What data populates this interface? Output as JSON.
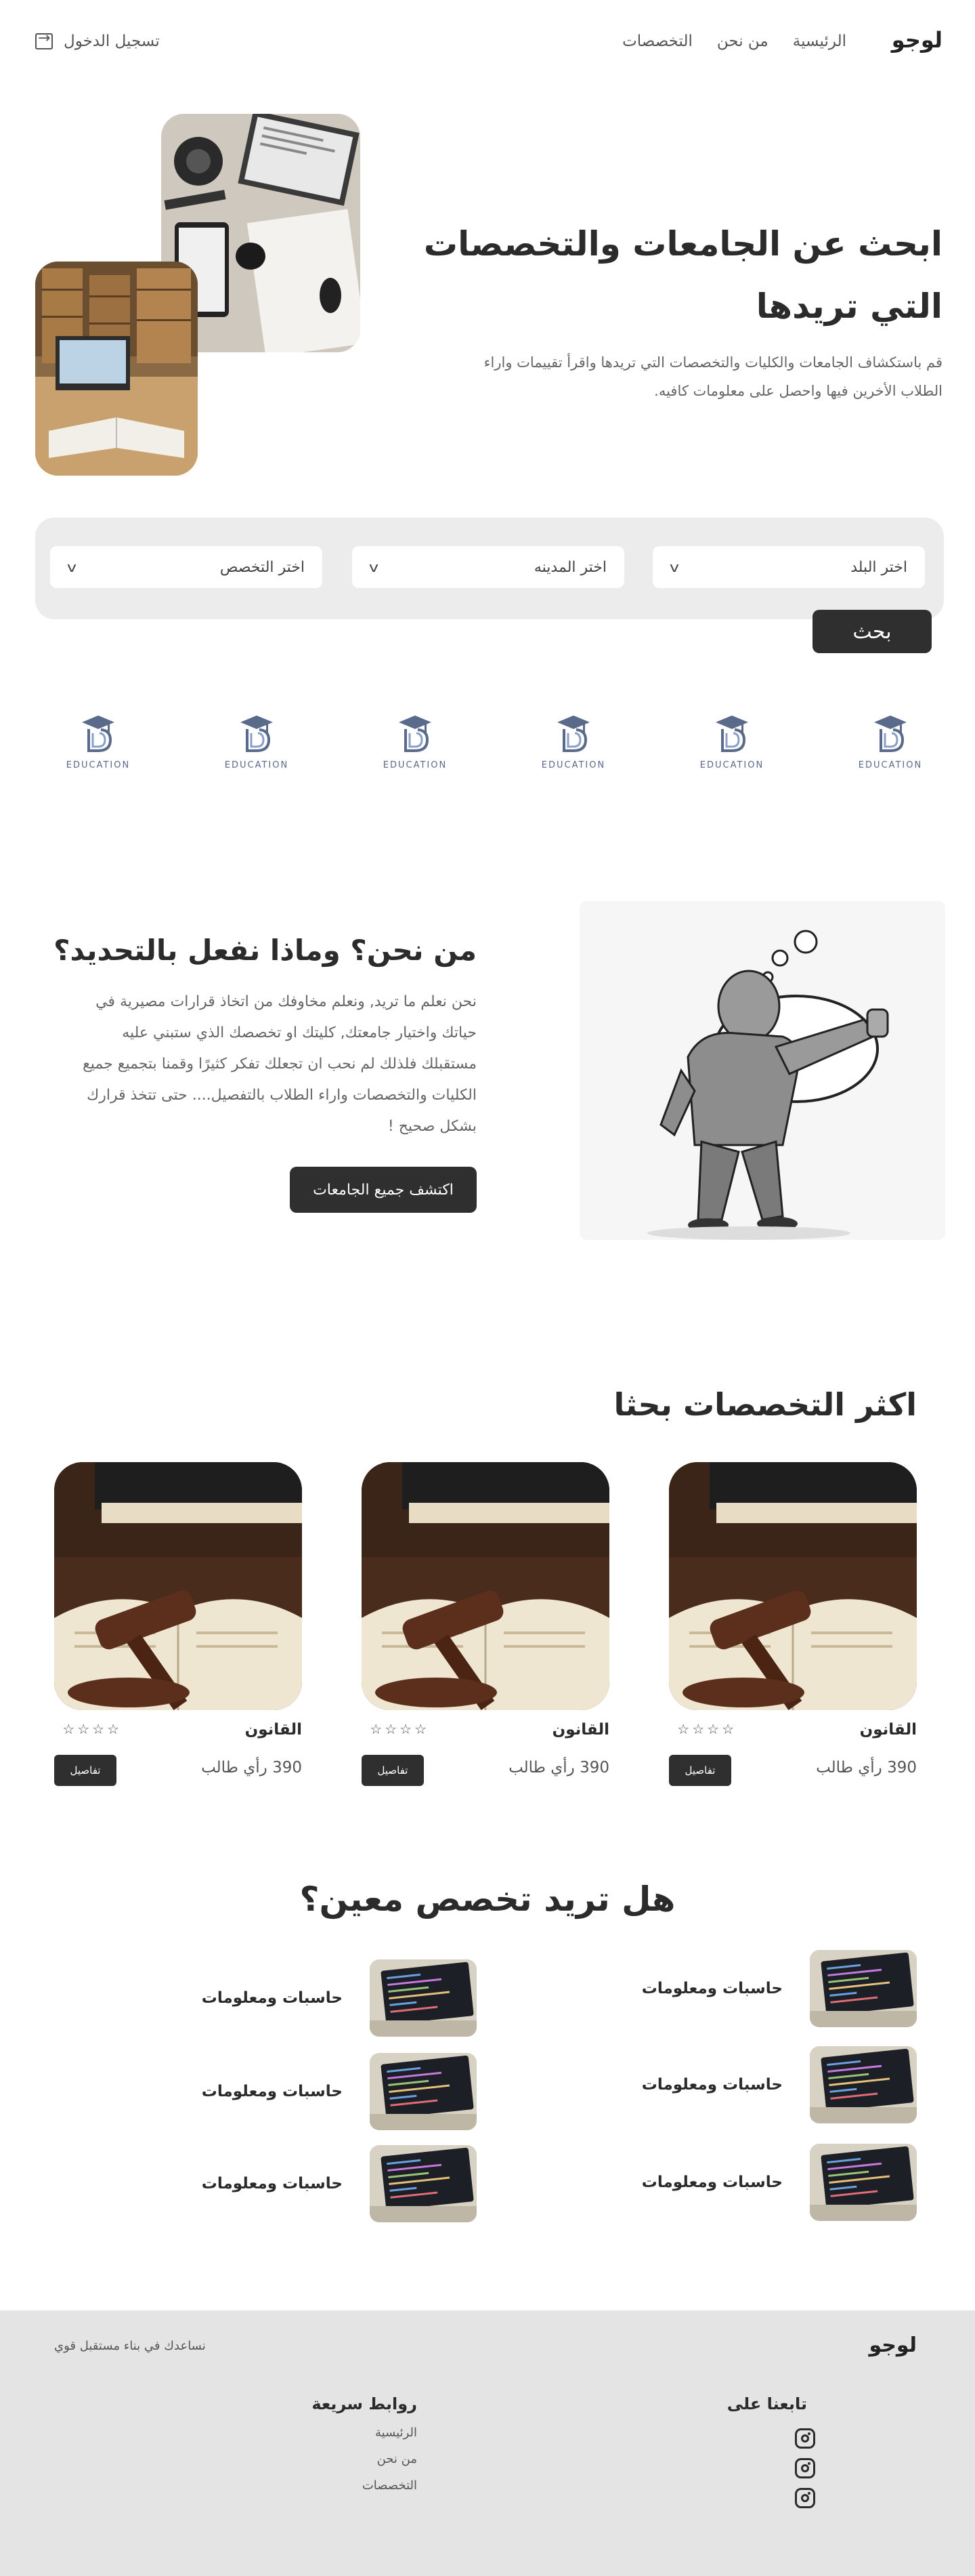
{
  "header": {
    "logo": "لوجو",
    "nav": [
      "الرئيسية",
      "من نحن",
      "التخصصات"
    ],
    "login_label": "تسجيل الدخول"
  },
  "hero": {
    "title_line1": "ابحث عن الجامعات والتخصصات",
    "title_line2": "التي تريدها",
    "subtitle_line1": "قم باستكشاف الجامعات والكليات والتخصصات التي تريدها واقرأ تقييمات واراء",
    "subtitle_line2": "الطلاب الأخرين فيها واحصل على معلومات كافيه."
  },
  "search": {
    "country_placeholder": "اختر البلد",
    "city_placeholder": "اختر المدينه",
    "major_placeholder": "اختر التخصص",
    "chevron": "v",
    "button_label": "بحث"
  },
  "partners": {
    "label": "EDUCATION",
    "count": 6,
    "icon": "graduation-cap-icon"
  },
  "about": {
    "title": "من نحن؟ وماذا نفعل بالتحديد؟",
    "lines": [
      "نحن نعلم ما تريد, ونعلم مخاوفك من اتخاذ قرارات مصيرية في",
      "حياتك واختيار جامعتك, كليتك او تخصصك الذي ستبني عليه",
      "مستقبلك فلذلك لم نحب ان تجعلك تفكر كثيرًا وقمنا بتجميع جميع",
      "الكليات والتخصصات واراء الطلاب بالتفصيل.... حتى تتخذ قرارك",
      "بشكل صحيح !"
    ],
    "button_label": "اكتشف جميع الجامعات"
  },
  "popular": {
    "title": "اكثر التخصصات بحثا",
    "cards": [
      {
        "name": "القانون",
        "stars": "☆☆☆☆",
        "count": "390 رأي طالب",
        "button": "تفاصيل"
      },
      {
        "name": "القانون",
        "stars": "☆☆☆☆",
        "count": "390 رأي طالب",
        "button": "تفاصيل"
      },
      {
        "name": "القانون",
        "stars": "☆☆☆☆",
        "count": "390 رأي طالب",
        "button": "تفاصيل"
      }
    ]
  },
  "specific": {
    "title": "هل تريد تخصص معين؟",
    "items": [
      "حاسبات ومعلومات",
      "حاسبات ومعلومات",
      "حاسبات ومعلومات",
      "حاسبات ومعلومات",
      "حاسبات ومعلومات",
      "حاسبات ومعلومات"
    ]
  },
  "footer": {
    "logo": "لوجو",
    "tagline": "نساعدك في بناء مستقبل قوي",
    "follow_title": "تابعنا على",
    "social_icon": "instagram-icon",
    "links_title": "روابط سريعة",
    "links": [
      "الرئيسية",
      "من نحن",
      "التخصصات"
    ]
  },
  "colors": {
    "dark_button": "#2f2f2f",
    "search_bg": "#ececec",
    "footer_bg": "#e4e4e4"
  }
}
